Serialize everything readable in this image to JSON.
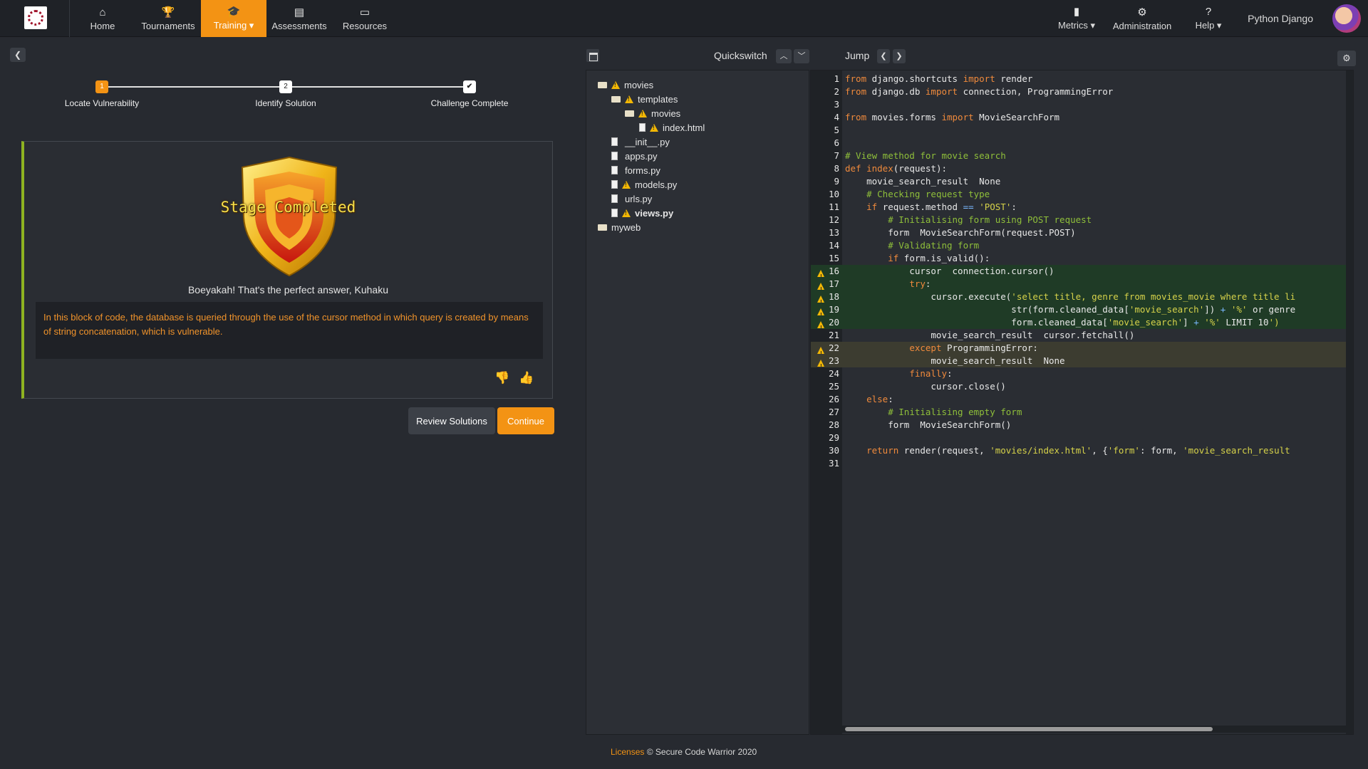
{
  "nav": {
    "items": [
      {
        "label": "Home",
        "icon": "home-icon"
      },
      {
        "label": "Tournaments",
        "icon": "trophy-icon"
      },
      {
        "label": "Training ▾",
        "icon": "graduation-cap-icon"
      },
      {
        "label": "Assessments",
        "icon": "document-icon"
      },
      {
        "label": "Resources",
        "icon": "presentation-icon"
      },
      {
        "label": "Metrics ▾",
        "icon": "bar-chart-icon"
      },
      {
        "label": "Administration",
        "icon": "gear-icon"
      },
      {
        "label": "Help ▾",
        "icon": "question-icon"
      }
    ],
    "user": "Python Django",
    "active_color": "#f39314"
  },
  "steps": [
    {
      "num": "1",
      "label": "Locate Vulnerability"
    },
    {
      "num": "2",
      "label": "Identify Solution"
    },
    {
      "num": "✔",
      "label": "Challenge Complete"
    }
  ],
  "card": {
    "badge_title": "Stage Completed",
    "praise": "Boeyakah! That's the perfect answer, Kuhaku",
    "explanation": "In this block of code, the database is queried through the use of the cursor method in which query is created by means of string concatenation, which is vulnerable."
  },
  "buttons": {
    "review": "Review Solutions",
    "continue": "Continue"
  },
  "toolbar": {
    "quickswitch": "Quickswitch",
    "jump": "Jump"
  },
  "tree": [
    {
      "label": "movies",
      "type": "folder",
      "warn": true
    },
    {
      "label": "templates",
      "type": "folder",
      "warn": true
    },
    {
      "label": "movies",
      "type": "folder",
      "warn": true
    },
    {
      "label": "index.html",
      "type": "file",
      "warn": true
    },
    {
      "label": "__init__.py",
      "type": "file",
      "warn": false
    },
    {
      "label": "apps.py",
      "type": "file",
      "warn": false
    },
    {
      "label": "forms.py",
      "type": "file",
      "warn": false
    },
    {
      "label": "models.py",
      "type": "file",
      "warn": true
    },
    {
      "label": "urls.py",
      "type": "file",
      "warn": false
    },
    {
      "label": "views.py",
      "type": "file",
      "warn": true,
      "bold": true
    },
    {
      "label": "myweb",
      "type": "folder",
      "warn": false
    }
  ],
  "code": {
    "warn_lines": [
      16,
      17,
      18,
      19,
      20,
      22,
      23
    ],
    "green_lines": [
      16,
      17,
      18,
      19,
      20
    ],
    "olive_lines": [
      22,
      23
    ],
    "lines": [
      "from django.shortcuts import render",
      "from django.db import connection, ProgrammingError",
      "",
      "from movies.forms import MovieSearchForm",
      "",
      "",
      "# View method for movie search",
      "def index(request):",
      "    movie_search_result = None",
      "    # Checking request type",
      "    if request.method == 'POST':",
      "        # Initialising form using POST request",
      "        form = MovieSearchForm(request.POST)",
      "        # Validating form",
      "        if form.is_valid():",
      "            cursor = connection.cursor()",
      "            try:",
      "                cursor.execute('select title, genre from movies_movie where title li",
      "                               str(form.cleaned_data['movie_search']) + '%' or genre",
      "                               form.cleaned_data['movie_search'] + '%' LIMIT 10')",
      "                movie_search_result = cursor.fetchall()",
      "            except ProgrammingError:",
      "                movie_search_result = None",
      "            finally:",
      "                cursor.close()",
      "    else:",
      "        # Initialising empty form",
      "        form = MovieSearchForm()",
      "",
      "    return render(request, 'movies/index.html', {'form': form, 'movie_search_result",
      ""
    ]
  },
  "footer": {
    "licenses": "Licenses",
    "copyright": "© Secure Code Warrior 2020"
  }
}
